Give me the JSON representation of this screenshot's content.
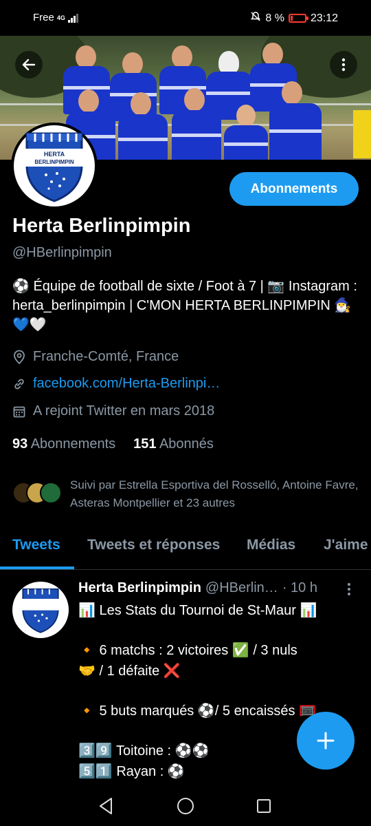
{
  "status": {
    "carrier": "Free",
    "network": "4G",
    "battery": "8 %",
    "time": "23:12"
  },
  "profile": {
    "name": "Herta Berlinpimpin",
    "handle": "@HBerlinpimpin",
    "follow_button": "Abonnements",
    "bio": "⚽ Équipe de football de sixte / Foot à 7 |  📷 Instagram : herta_berlinpimpin | C'MON HERTA BERLINPIMPIN 🧙‍♂️💙🤍",
    "location": "Franche-Comté, France",
    "link": "facebook.com/Herta-Berlinpi…",
    "joined": "A rejoint Twitter en mars 2018",
    "following_count": "93",
    "following_label": "Abonnements",
    "followers_count": "151",
    "followers_label": "Abonnés",
    "followed_by": "Suivi par Estrella Esportiva del Rosselló, Antoine Favre, Asteras Montpellier et 23 autres",
    "logo_text_line1": "HERTA",
    "logo_text_line2": "BERLINPIMPIN"
  },
  "tabs": [
    "Tweets",
    "Tweets et réponses",
    "Médias",
    "J'aime"
  ],
  "tweet": {
    "name": "Herta Berlinpimpin",
    "handle": "@HBerlin…",
    "time": "· 10 h",
    "lines": [
      "📊 Les Stats du Tournoi de St-Maur  📊",
      "🔸 6 matchs : 2 victoires ✅ / 3 nuls",
      "🤝 / 1 défaite ❌",
      "🔸 5 buts marqués ⚽/ 5 encaissés 🥅",
      "3️⃣9️⃣ Toitoine : ⚽⚽",
      "5️⃣1️⃣ Rayan : ⚽"
    ]
  },
  "colors": {
    "accent": "#1d9bf0",
    "background": "#000000",
    "secondary_text": "#8b98a5",
    "battery_low": "#ff3b30"
  },
  "icons": {
    "back": "arrow-left-icon",
    "more": "more-vertical-icon",
    "location": "location-pin-icon",
    "link": "link-icon",
    "calendar": "calendar-icon",
    "compose": "plus-icon"
  }
}
